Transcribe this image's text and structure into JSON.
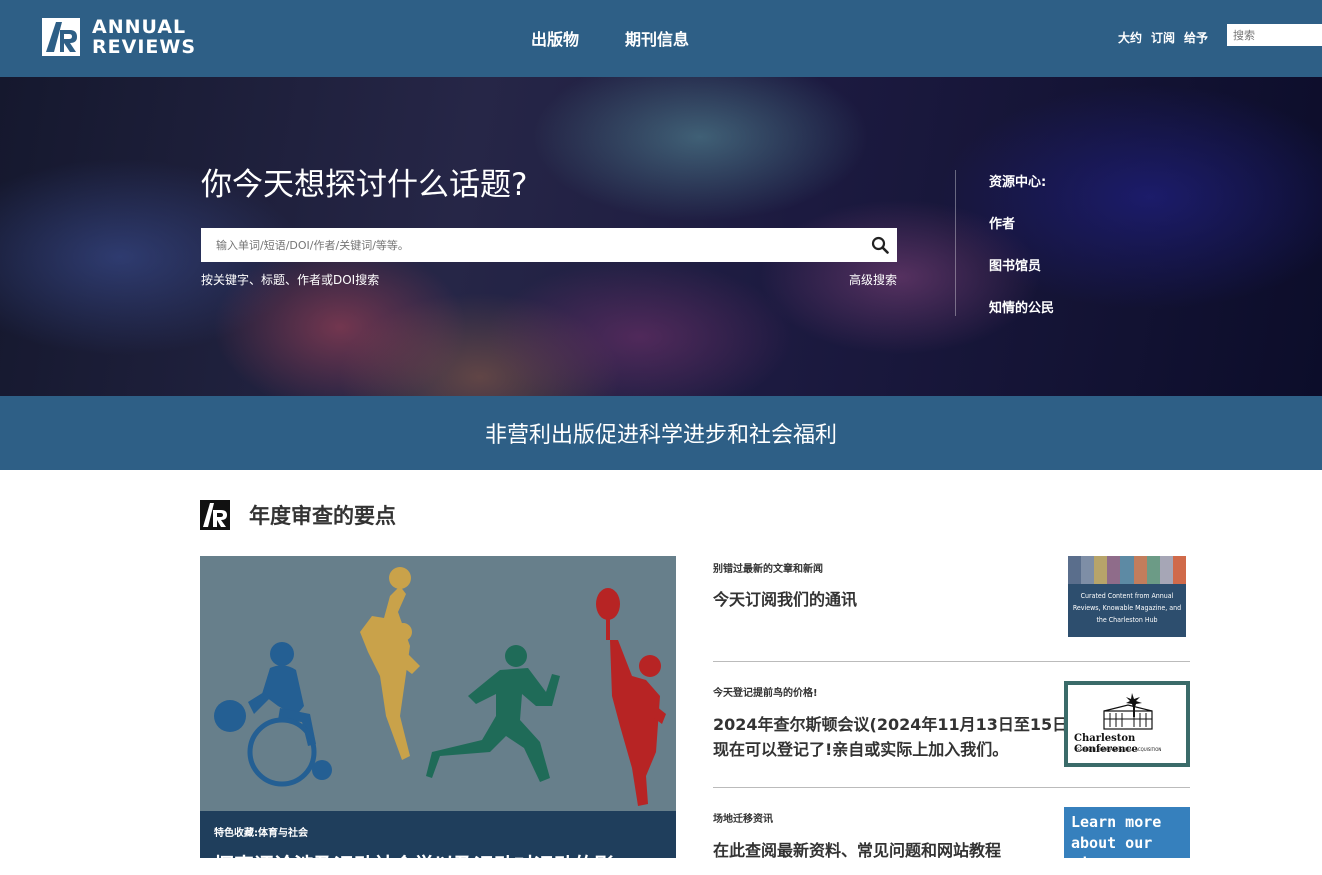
{
  "header": {
    "logo_line1": "ANNUAL",
    "logo_line2": "REVIEWS",
    "nav": [
      "出版物",
      "期刊信息"
    ],
    "utility": [
      "大约",
      "订阅",
      "给予"
    ],
    "search_placeholder": "搜索"
  },
  "hero": {
    "title": "你今天想探讨什么话题?",
    "search_placeholder": "输入单词/短语/DOI/作者/关键词/等等。",
    "hint": "按关键字、标题、作者或DOI搜索",
    "advanced": "高级搜索",
    "resources_heading": "资源中心:",
    "resources": [
      "作者",
      "图书馆员",
      "知情的公民"
    ]
  },
  "mission": "非营利出版促进科学进步和社会福利",
  "highlights": {
    "title": "年度审查的要点",
    "feature": {
      "tag": "特色收藏:体育与社会",
      "title": "探索评论涉及运动社会学以及运动对运动的影"
    },
    "news": [
      {
        "kicker": "别错过最新的文章和新闻",
        "headline": "今天订阅我们的通讯",
        "thumb_text": "Curated Content from Annual Reviews, Knowable Magazine, and the Charleston Hub"
      },
      {
        "kicker": "今天登记提前鸟的价格!",
        "headline_line1": "2024年查尔斯顿会议(2024年11月13日至15日)",
        "headline_line2": "现在可以登记了!亲自或实际上加入我们。",
        "thumb_name": "Charleston Conference",
        "thumb_sub": "ISSUES IN BOOK AND SERIAL ACQUISITION"
      },
      {
        "kicker": "场地迁移资讯",
        "headline": "在此查阅最新资料、常见问题和网站教程",
        "thumb_line1": "Learn more",
        "thumb_line2": "about our site"
      }
    ]
  },
  "colors": {
    "brand_blue": "#2e5f86",
    "feature_bg": "#677f8b",
    "feature_caption": "#1f3e5c",
    "learn_blue": "#3680bd"
  }
}
